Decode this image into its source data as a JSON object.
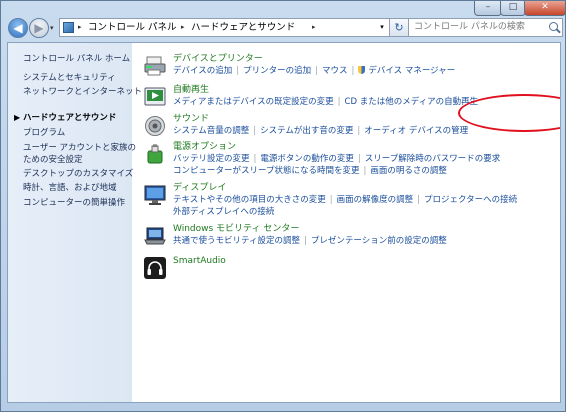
{
  "window": {
    "minimize_glyph": "–",
    "maximize_glyph": "□",
    "close_glyph": "✕"
  },
  "toolbar": {
    "back_glyph": "◀",
    "forward_glyph": "▶",
    "history_glyph": "▾",
    "breadcrumbs": [
      "コントロール パネル",
      "ハードウェアとサウンド"
    ],
    "crumb_arrow": "▸",
    "address_drop_glyph": "▾",
    "refresh_glyph": "↻",
    "search_placeholder": "コントロール パネルの検索"
  },
  "sidebar": {
    "items": [
      {
        "label": "コントロール パネル ホーム",
        "current": false
      },
      {
        "label": "システムとセキュリティ",
        "current": false
      },
      {
        "label": "ネットワークとインターネット",
        "current": false
      },
      {
        "label": "ハードウェアとサウンド",
        "current": true
      },
      {
        "label": "プログラム",
        "current": false
      },
      {
        "label": "ユーザー アカウントと家族の",
        "current": false
      },
      {
        "label": "ための安全設定",
        "current": false
      },
      {
        "label": "デスクトップのカスタマイズ",
        "current": false
      },
      {
        "label": "時計、言語、および地域",
        "current": false
      },
      {
        "label": "コンピューターの簡単操作",
        "current": false
      }
    ],
    "current_bullet": "▶"
  },
  "categories": [
    {
      "title": "デバイスとプリンター",
      "icon": "printer-icon",
      "rows": [
        [
          "デバイスの追加",
          "プリンターの追加",
          "マウス",
          "デバイス マネージャー"
        ]
      ]
    },
    {
      "title": "自動再生",
      "icon": "autoplay-icon",
      "rows": [
        [
          "メディアまたはデバイスの既定設定の変更",
          "CD または他のメディアの自動再生"
        ]
      ]
    },
    {
      "title": "サウンド",
      "icon": "speaker-icon",
      "rows": [
        [
          "システム音量の調整",
          "システムが出す音の変更",
          "オーディオ デバイスの管理"
        ]
      ]
    },
    {
      "title": "電源オプション",
      "icon": "power-options-icon",
      "rows": [
        [
          "バッテリ設定の変更",
          "電源ボタンの動作の変更",
          "スリープ解除時のパスワードの要求"
        ],
        [
          "コンピューターがスリープ状態になる時間を変更",
          "画面の明るさの調整"
        ]
      ]
    },
    {
      "title": "ディスプレイ",
      "icon": "display-icon",
      "rows": [
        [
          "テキストやその他の項目の大きさの変更",
          "画面の解像度の調整",
          "プロジェクターへの接続"
        ],
        [
          "外部ディスプレイへの接続"
        ]
      ]
    },
    {
      "title": "Windows モビリティ センター",
      "icon": "mobility-center-icon",
      "rows": [
        [
          "共通で使うモビリティ設定の調整",
          "プレゼンテーション前の設定の調整"
        ]
      ]
    },
    {
      "title": "SmartAudio",
      "icon": "headphones-icon",
      "rows": []
    }
  ],
  "colors": {
    "category_title": "#1e7a1e",
    "link": "#1a4e9c",
    "annotation": "#e0101e"
  }
}
